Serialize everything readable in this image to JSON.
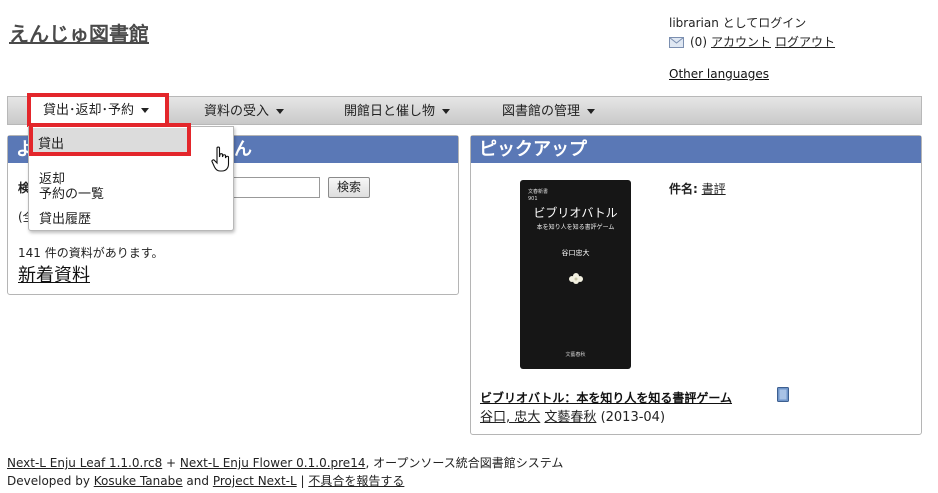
{
  "header": {
    "site_title": "えんじゅ図書館",
    "login_text": "librarian としてログイン",
    "message_count": "(0)",
    "account_link": "アカウント",
    "logout_link": "ログアウト",
    "other_languages": "Other languages"
  },
  "nav": {
    "items": [
      {
        "label": "貸出･返却･予約"
      },
      {
        "label": "資料の受入"
      },
      {
        "label": "開館日と催し物"
      },
      {
        "label": "図書館の管理"
      }
    ]
  },
  "dropdown": {
    "items": [
      {
        "label": "貸出"
      },
      {
        "label": "返却"
      },
      {
        "label": "予約の一覧"
      },
      {
        "label": "貸出履歴"
      }
    ]
  },
  "left_panel": {
    "title_visible_part": "よ",
    "title_suffix": "ん",
    "search_label": "検",
    "search_button": "検索",
    "sub_note": "(全",
    "count_text": "141 件の資料があります。",
    "new_items": "新着資料"
  },
  "pickup": {
    "title": "ピックアップ",
    "subject_label": "件名:",
    "subject_value": "書評",
    "cover": {
      "series": "文春新書",
      "number": "901",
      "title": "ビブリオバトル",
      "subtitle": "本を知り人を知る書評ゲーム",
      "author": "谷口忠大",
      "publisher": "文藝春秋"
    },
    "book_title": "ビブリオバトル：本を知り人を知る書評ゲーム",
    "author": "谷口, 忠大",
    "publisher": "文藝春秋",
    "date": "(2013-04)"
  },
  "footer": {
    "leaf": "Next-L Enju Leaf 1.1.0.rc8",
    "plus": " + ",
    "flower": "Next-L Enju Flower 0.1.0.pre14",
    "system_desc": ", オープンソース統合図書館システム",
    "developed_by": "Developed by ",
    "kosuke": "Kosuke Tanabe",
    "and": " and ",
    "project": "Project Next-L",
    "sep": " | ",
    "report": "不具合を報告する"
  }
}
